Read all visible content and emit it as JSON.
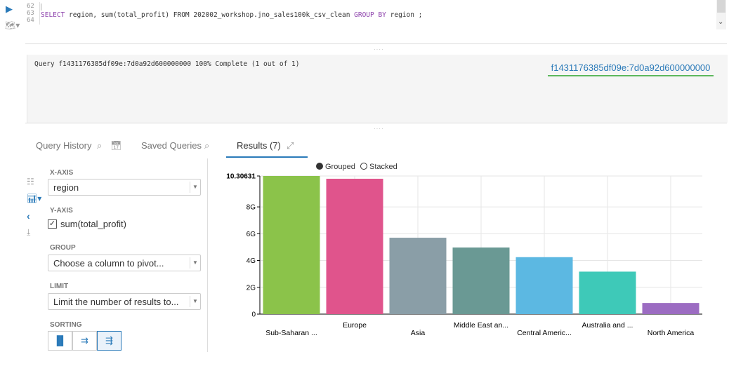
{
  "editor": {
    "line_numbers": [
      "62",
      "63",
      "64"
    ],
    "sql": {
      "select": "SELECT",
      "body": " region, sum(total_profit) FROM 202002_workshop.jno_sales100k_csv_clean ",
      "group_by": "GROUP BY",
      "tail": " region ;"
    }
  },
  "log": {
    "message": "Query f1431176385df09e:7d0a92d600000000 100% Complete (1 out of 1)",
    "job_link": "f1431176385df09e:7d0a92d600000000"
  },
  "tabs": {
    "query_history": "Query History",
    "saved_queries": "Saved Queries",
    "results": "Results (7)"
  },
  "settings": {
    "x_axis_label": "X-AXIS",
    "x_axis_value": "region",
    "y_axis_label": "Y-AXIS",
    "y_axis_value": "sum(total_profit)",
    "group_label": "GROUP",
    "group_placeholder": "Choose a column to pivot...",
    "limit_label": "LIMIT",
    "limit_placeholder": "Limit the number of results to...",
    "sorting_label": "SORTING"
  },
  "legend": {
    "grouped": "Grouped",
    "stacked": "Stacked",
    "selected": "grouped"
  },
  "chart_data": {
    "type": "bar",
    "categories": [
      "Sub-Saharan ...",
      "Europe",
      "Asia",
      "Middle East an...",
      "Central Americ...",
      "Australia and ...",
      "North America"
    ],
    "values": [
      10.30631,
      10.1,
      5.7,
      4.97,
      4.25,
      3.17,
      0.83
    ],
    "value_unit": "G",
    "colors": [
      "#8bc34a",
      "#e0548c",
      "#8a9ea7",
      "#6a9994",
      "#5cb8e2",
      "#3ec9b8",
      "#9c6cc2"
    ],
    "y_ticks": [
      "0",
      "2G",
      "4G",
      "6G",
      "8G",
      "10.30631"
    ],
    "y_tick_values": [
      0,
      2,
      4,
      6,
      8,
      10.30631
    ],
    "ylim": [
      0,
      10.30631
    ],
    "grid": true
  }
}
